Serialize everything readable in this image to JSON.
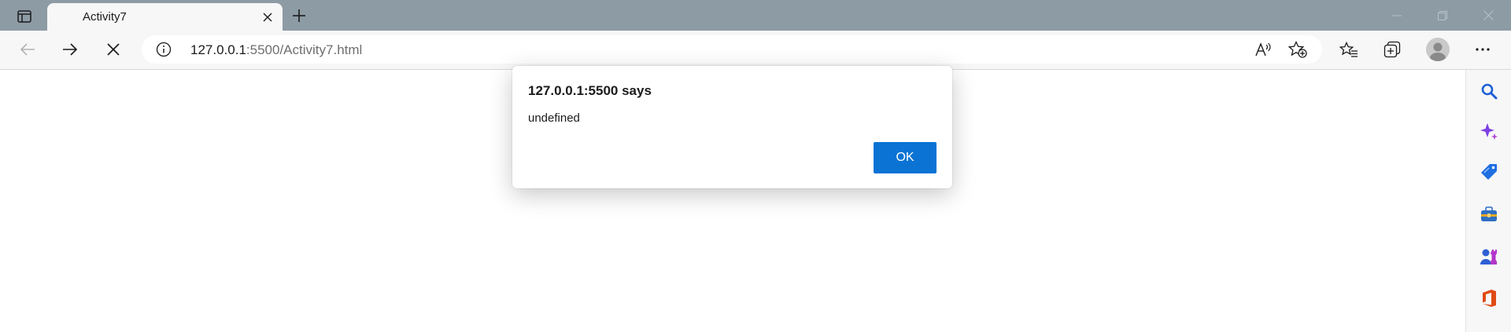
{
  "browser": {
    "tab": {
      "title": "Activity7"
    },
    "address_bar": {
      "host": "127.0.0.1",
      "port_path": ":5500/Activity7.html"
    },
    "icons": {
      "tab_actions": "tab-actions-icon",
      "close_tab": "close-icon",
      "new_tab": "plus-icon",
      "back": "arrow-left-icon",
      "forward": "arrow-right-icon",
      "stop": "stop-icon",
      "site_info": "info-icon",
      "read_aloud": "read-aloud-icon",
      "add_favorite": "star-add-icon",
      "favorites": "favorites-icon",
      "collections": "collections-icon",
      "profile": "avatar",
      "more": "more-icon"
    },
    "sidebar": [
      "search-icon",
      "copilot-icon",
      "shopping-tag-icon",
      "tools-icon",
      "games-icon",
      "office-icon"
    ]
  },
  "dialog": {
    "title": "127.0.0.1:5500 says",
    "message": "undefined",
    "ok_label": "OK",
    "accent": "#0a73d4"
  }
}
